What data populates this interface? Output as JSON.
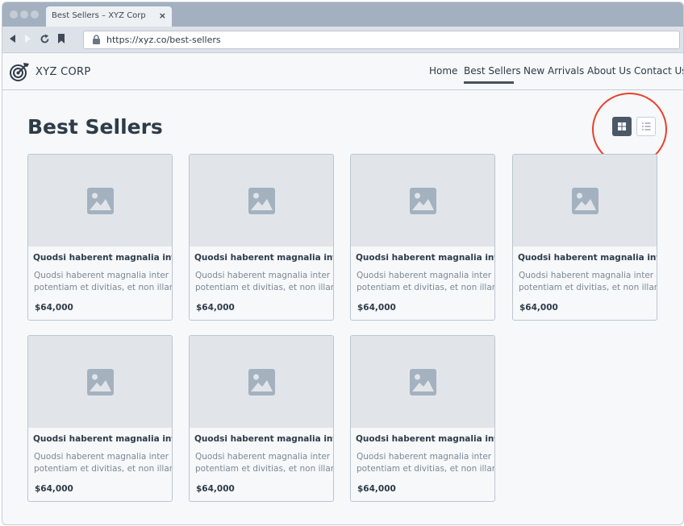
{
  "browser": {
    "tab_title": "Best Sellers – XYZ Corp",
    "tab_close": "×",
    "url": "https://xyz.co/best-sellers"
  },
  "site": {
    "brand": "XYZ CORP",
    "nav": [
      {
        "label": "Home",
        "active": false
      },
      {
        "label": "Best Sellers",
        "active": true
      },
      {
        "label": "New Arrivals",
        "active": false
      },
      {
        "label": "About Us",
        "active": false
      },
      {
        "label": "Contact Us",
        "active": false
      }
    ]
  },
  "page": {
    "title": "Best Sellers",
    "view_mode": "grid"
  },
  "products": [
    {
      "name": "Quodsi haberent magnalia inter",
      "desc1": "Quodsi haberent magnalia inter",
      "desc2": "potentiam et divitias, et non illam",
      "price": "$64,000"
    },
    {
      "name": "Quodsi haberent magnalia inter",
      "desc1": "Quodsi haberent magnalia inter",
      "desc2": "potentiam et divitias, et non illam",
      "price": "$64,000"
    },
    {
      "name": "Quodsi haberent magnalia inter",
      "desc1": "Quodsi haberent magnalia inter",
      "desc2": "potentiam et divitias, et non illam",
      "price": "$64,000"
    },
    {
      "name": "Quodsi haberent magnalia inter",
      "desc1": "Quodsi haberent magnalia inter",
      "desc2": "potentiam et divitias, et non illam",
      "price": "$64,000"
    },
    {
      "name": "Quodsi haberent magnalia inter",
      "desc1": "Quodsi haberent magnalia inter",
      "desc2": "potentiam et divitias, et non illam",
      "price": "$64,000"
    },
    {
      "name": "Quodsi haberent magnalia inter",
      "desc1": "Quodsi haberent magnalia inter",
      "desc2": "potentiam et divitias, et non illam",
      "price": "$64,000"
    },
    {
      "name": "Quodsi haberent magnalia inter",
      "desc1": "Quodsi haberent magnalia inter",
      "desc2": "potentiam et divitias, et non illam",
      "price": "$64,000"
    }
  ],
  "colors": {
    "highlight": "#e8412c",
    "text": "#2e3b48",
    "muted": "#7c8896",
    "active_toggle": "#4b5866"
  }
}
